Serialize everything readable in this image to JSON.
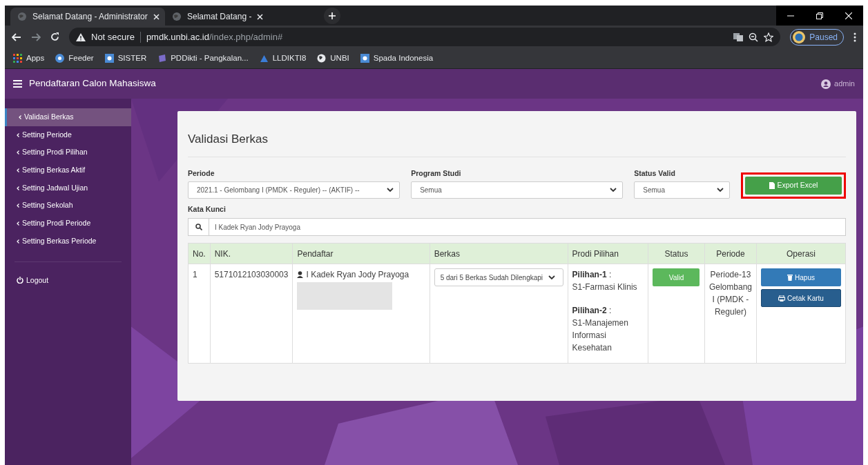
{
  "browser": {
    "tabs": [
      {
        "title": "Selamat Datang - Administrator",
        "selected": true
      },
      {
        "title": "Selamat Datang -",
        "selected": false
      }
    ],
    "address": {
      "security": "Not secure",
      "host": "pmdk.unbi.ac.id",
      "path": "/index.php/admin#"
    },
    "bookmarks": [
      "Apps",
      "Feeder",
      "SISTER",
      "PDDikti - Pangkalan...",
      "LLDIKTI8",
      "UNBI",
      "Spada Indonesia"
    ],
    "profile": "Paused"
  },
  "app": {
    "title": "Pendaftaran Calon Mahasiswa",
    "user": "admin"
  },
  "sidebar": {
    "items": [
      {
        "label": "Validasi Berkas",
        "selected": true
      },
      {
        "label": "Setting Periode",
        "selected": false
      },
      {
        "label": "Setting Prodi Pilihan",
        "selected": false
      },
      {
        "label": "Setting Berkas Aktif",
        "selected": false
      },
      {
        "label": "Setting Jadwal Ujian",
        "selected": false
      },
      {
        "label": "Setting Sekolah",
        "selected": false
      },
      {
        "label": "Setting Prodi Periode",
        "selected": false
      },
      {
        "label": "Setting Berkas Periode",
        "selected": false
      }
    ],
    "logout": "Logout"
  },
  "page_title": "Validasi Berkas",
  "filters": [
    {
      "label": "Periode",
      "value": "2021.1 - Gelombang I (PMDK - Reguler) -- (AKTIF) --"
    },
    {
      "label": "Program Studi",
      "value": "Semua"
    },
    {
      "label": "Status Valid",
      "value": "Semua"
    }
  ],
  "export_button": {
    "label": "Export Excel",
    "highlighted": true
  },
  "keyword": {
    "label": "Kata Kunci",
    "value": "I Kadek Ryan Jody Prayoga"
  },
  "table": {
    "columns": [
      "No.",
      "NIK.",
      "Pendaftar",
      "Berkas",
      "Prodi Pilihan",
      "Status",
      "Periode",
      "Operasi"
    ],
    "rows": [
      {
        "no": "1",
        "nik": "5171012103030003",
        "name": "I Kadek Ryan Jody Prayoga",
        "berkas": "5 dari 5 Berkas Sudah Dilengkapi",
        "choices": [
          {
            "label": "**Pilihan-1** :",
            "program": "S1-Farmasi Klinis"
          },
          {
            "label": "**Pilihan-2** :",
            "program": "S1-Manajemen Informasi Kesehatan"
          }
        ],
        "status": "Valid",
        "periode": "Periode-13 Gelombang I (PMDK - Reguler)",
        "actions": [
          "Hapus",
          "Cetak Kartu"
        ]
      }
    ]
  }
}
